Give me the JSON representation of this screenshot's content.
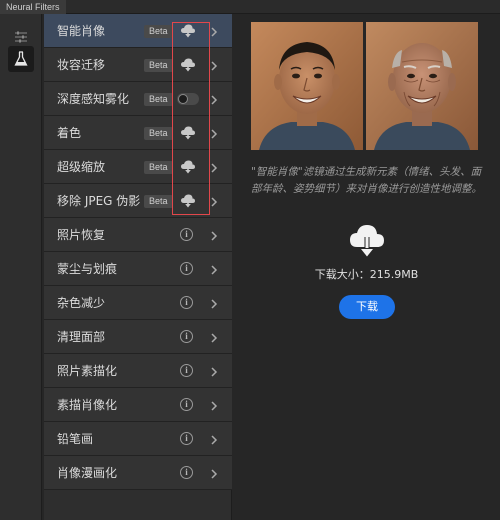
{
  "window": {
    "tab_title": "Neural Filters"
  },
  "filters": [
    {
      "label": "智能肖像",
      "badge": "Beta",
      "action": "download",
      "selected": true
    },
    {
      "label": "妆容迁移",
      "badge": "Beta",
      "action": "download"
    },
    {
      "label": "深度感知雾化",
      "badge": "Beta",
      "action": "toggle"
    },
    {
      "label": "着色",
      "badge": "Beta",
      "action": "download"
    },
    {
      "label": "超级缩放",
      "badge": "Beta",
      "action": "download"
    },
    {
      "label": "移除 JPEG 伪影",
      "badge": "Beta",
      "action": "download"
    },
    {
      "label": "照片恢复",
      "action": "info"
    },
    {
      "label": "蒙尘与划痕",
      "action": "info"
    },
    {
      "label": "杂色减少",
      "action": "info"
    },
    {
      "label": "清理面部",
      "action": "info"
    },
    {
      "label": "照片素描化",
      "action": "info"
    },
    {
      "label": "素描肖像化",
      "action": "info"
    },
    {
      "label": "铅笔画",
      "action": "info"
    },
    {
      "label": "肖像漫画化",
      "action": "info"
    }
  ],
  "detail": {
    "description": "\"智能肖像\"滤镜通过生成新元素（情绪、头发、面部年龄、姿势细节）来对肖像进行创造性地调整。",
    "download_size": "下载大小：215.9MB",
    "download_button": "下载"
  },
  "colors": {
    "accent": "#1e73e8",
    "highlight_box": "#e2474b",
    "selected_row": "#3d4a5e"
  }
}
